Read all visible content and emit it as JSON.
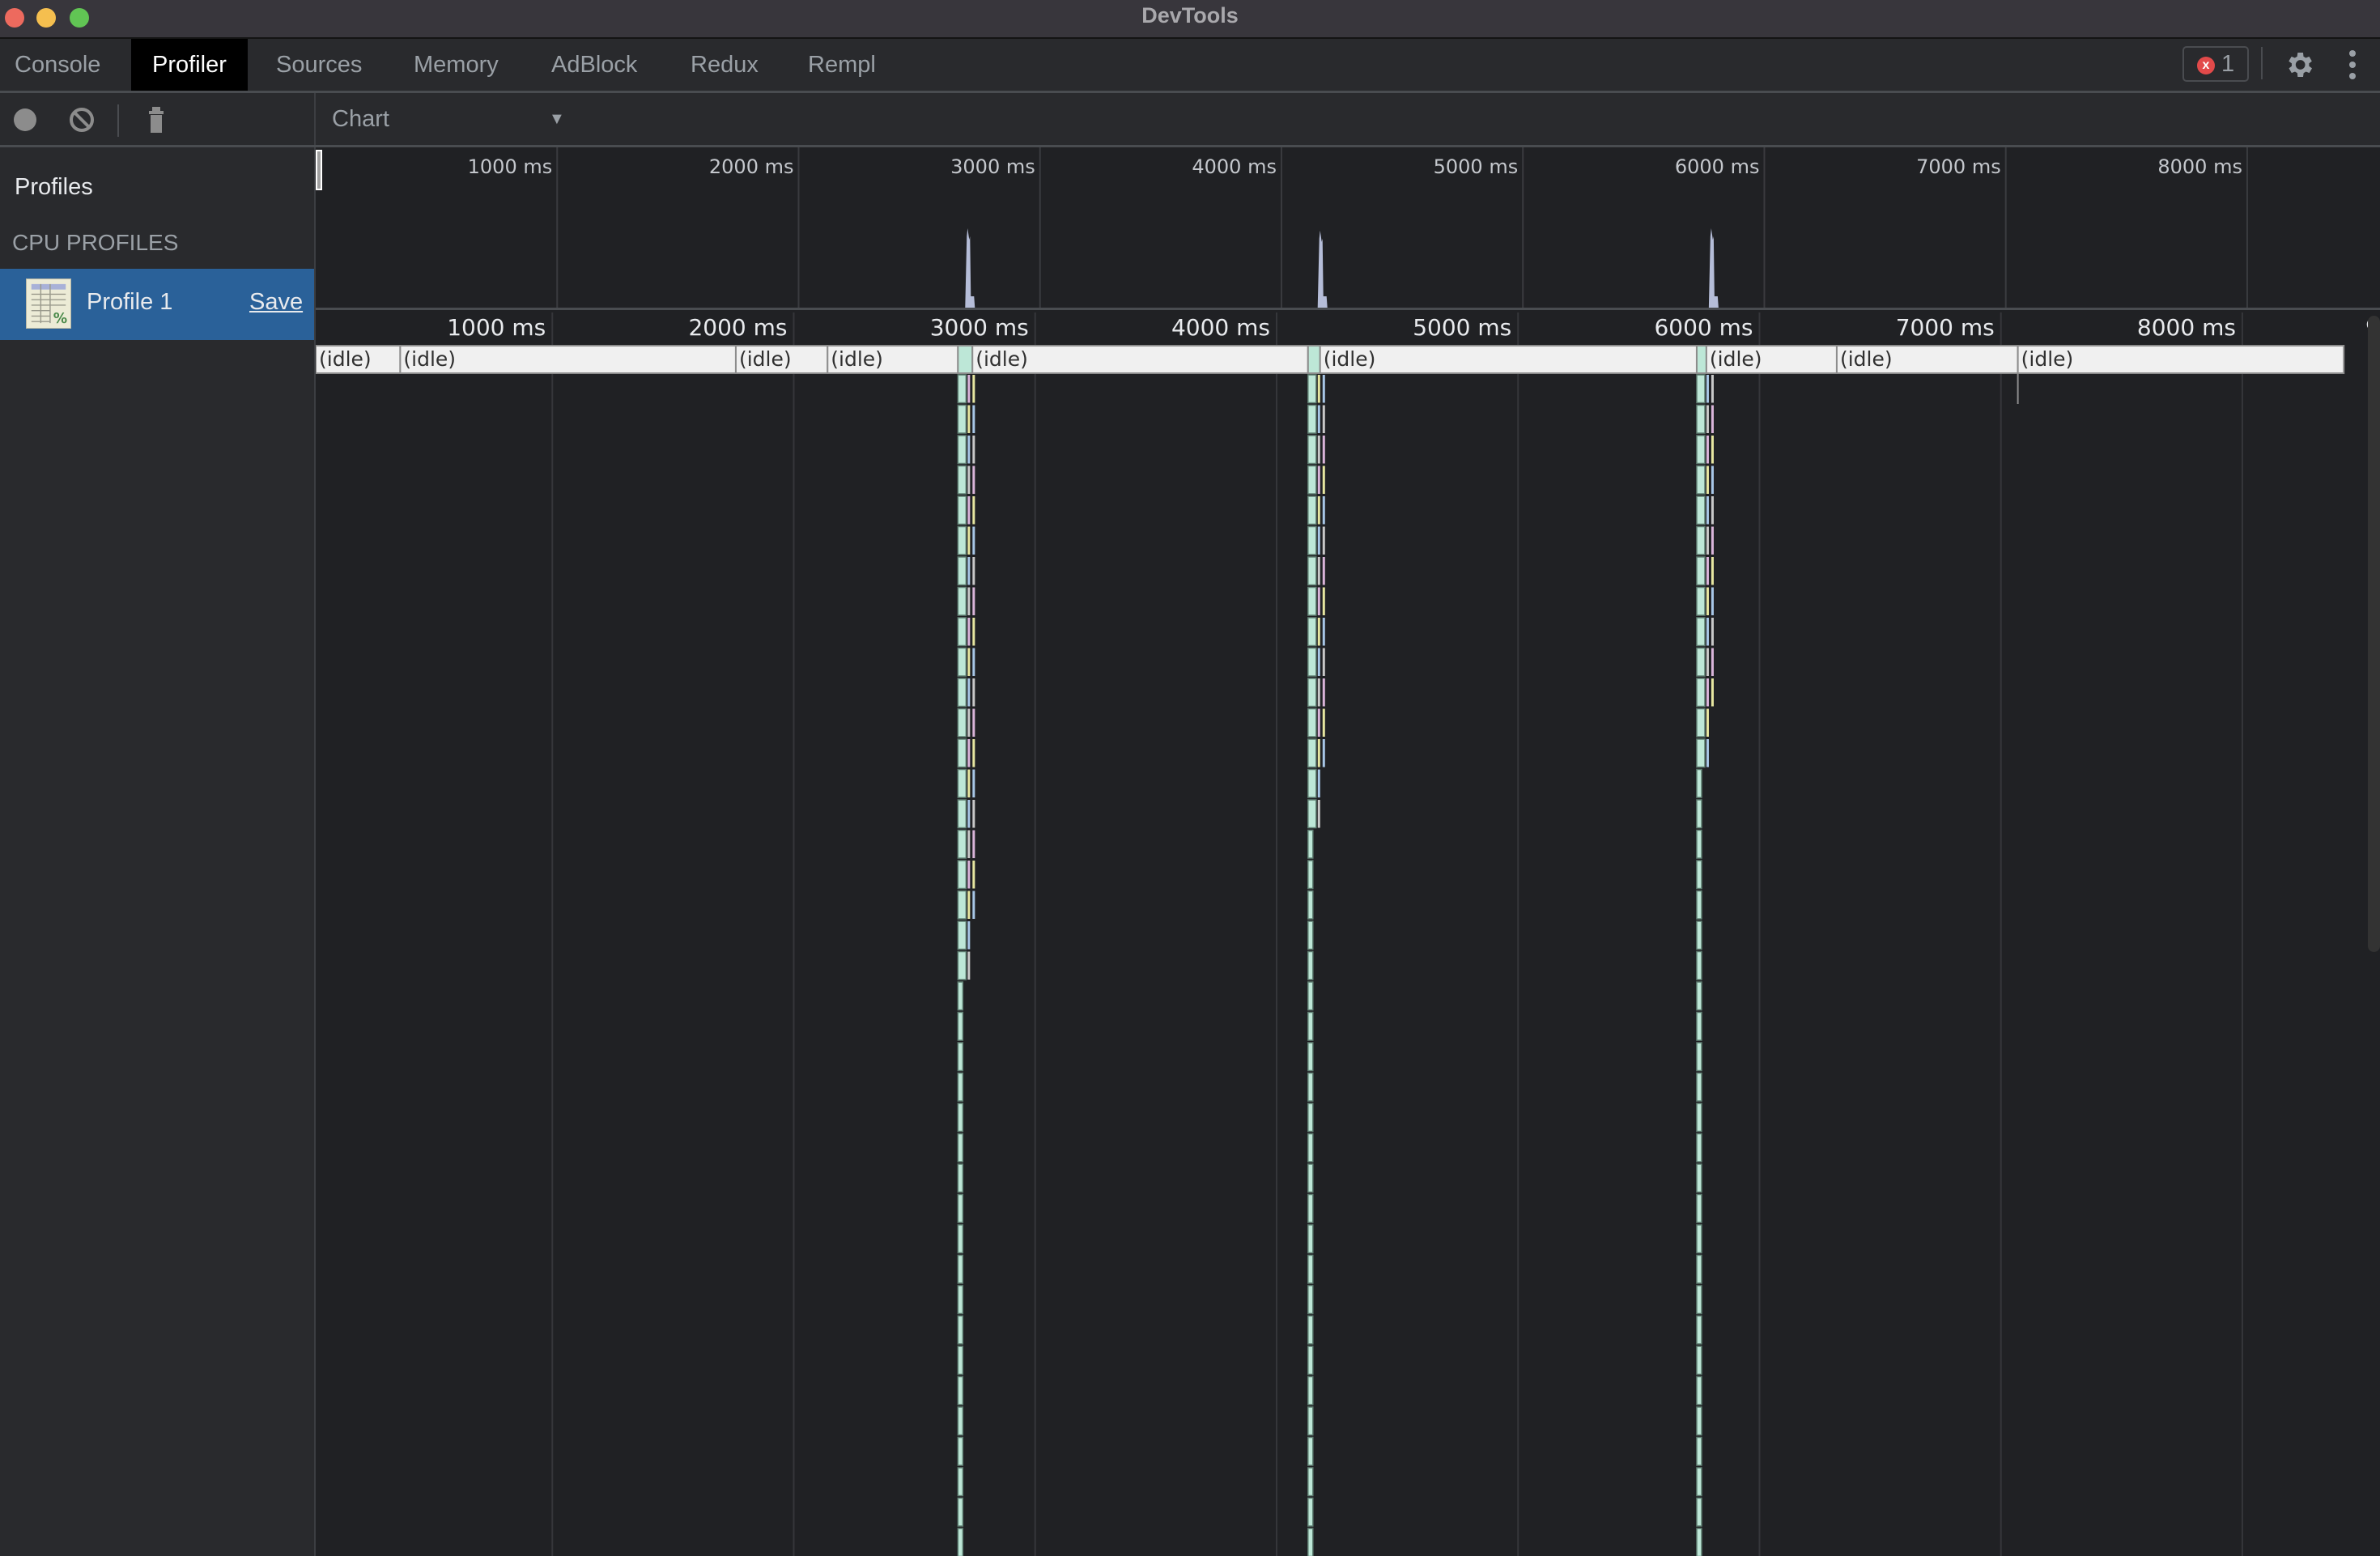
{
  "window": {
    "title": "DevTools"
  },
  "tabs": [
    {
      "label": "Console",
      "active": false
    },
    {
      "label": "Profiler",
      "active": true
    },
    {
      "label": "Sources",
      "active": false
    },
    {
      "label": "Memory",
      "active": false
    },
    {
      "label": "AdBlock",
      "active": false
    },
    {
      "label": "Redux",
      "active": false
    },
    {
      "label": "Rempl",
      "active": false
    }
  ],
  "error_badge": {
    "icon": "x",
    "count": "1"
  },
  "toolbar": {
    "record_icon": "record-icon",
    "clear_icon": "clear-icon",
    "delete_icon": "trash-icon",
    "view_mode": "Chart",
    "dropdown_icon": "▼"
  },
  "sidebar": {
    "title": "Profiles",
    "section": "CPU PROFILES",
    "profiles": [
      {
        "label": "Profile 1",
        "save_label": "Save",
        "selected": true
      }
    ]
  },
  "colors": {
    "accent_selected": "#2a6199",
    "flame_js": "#bde7d7",
    "idle": "#f0f0f0",
    "overview_cpu": "#b5bdd8"
  },
  "chart_data": {
    "type": "flame",
    "time_unit": "ms",
    "range_ms": [
      0,
      8550
    ],
    "overview_ticks": [
      "1000 ms",
      "2000 ms",
      "3000 ms",
      "4000 ms",
      "5000 ms",
      "6000 ms",
      "7000 ms",
      "8000 ms"
    ],
    "ruler_ticks": [
      "1000 ms",
      "2000 ms",
      "3000 ms",
      "4000 ms",
      "5000 ms",
      "6000 ms",
      "7000 ms",
      "8000 ms"
    ],
    "overview_tick_values": [
      1000,
      2000,
      3000,
      4000,
      5000,
      6000,
      7000,
      8000
    ],
    "overview_spikes": [
      {
        "time": 2700,
        "height": 0.7
      },
      {
        "time": 4160,
        "height": 0.68
      },
      {
        "time": 5780,
        "height": 0.7
      }
    ],
    "top_level_frames": [
      {
        "label": "(idle)",
        "start": 0,
        "end": 350
      },
      {
        "label": "(idle)",
        "start": 350,
        "end": 1740
      },
      {
        "label": "(idle)",
        "start": 1740,
        "end": 2120
      },
      {
        "label": "(idle)",
        "start": 2120,
        "end": 2660
      },
      {
        "label": "",
        "start": 2660,
        "end": 2720,
        "kind": "js"
      },
      {
        "label": "(idle)",
        "start": 2720,
        "end": 4110,
        "kind": "idle"
      },
      {
        "label": "",
        "start": 4110,
        "end": 4160,
        "kind": "js"
      },
      {
        "label": "(idle)",
        "start": 4160,
        "end": 5720
      },
      {
        "label": "",
        "start": 5720,
        "end": 5760,
        "kind": "js"
      },
      {
        "label": "(idle)",
        "start": 5760,
        "end": 6300
      },
      {
        "label": "(idle)",
        "start": 6300,
        "end": 7050
      },
      {
        "label": "(idle)",
        "start": 7050,
        "end": 8400
      }
    ],
    "call_stacks": [
      {
        "start": 2660,
        "width_ms": 55,
        "depth": 20,
        "deep_depth": 40
      },
      {
        "start": 4110,
        "width_ms": 45,
        "depth": 15,
        "deep_depth": 40
      },
      {
        "start": 5720,
        "width_ms": 40,
        "depth": 13,
        "deep_depth": 40
      }
    ]
  }
}
